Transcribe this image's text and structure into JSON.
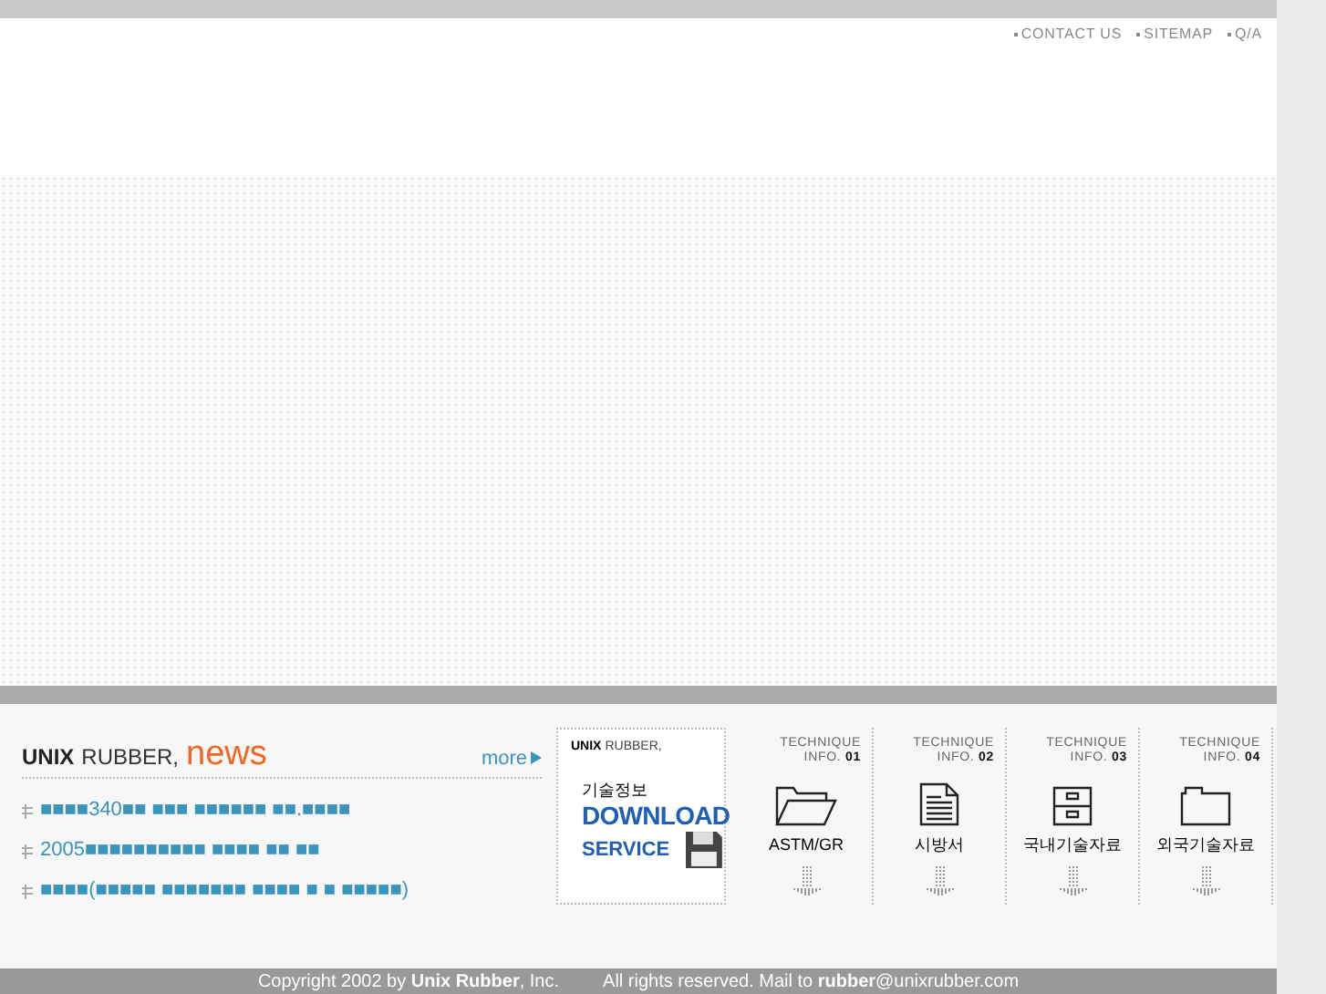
{
  "top_links": [
    "CONTACT US",
    "SITEMAP",
    "Q/A"
  ],
  "news": {
    "brand": "UNIX",
    "brand_rest": "RUBBER,",
    "title": "news",
    "more": "more",
    "items": [
      "■■■■340■■ ■■■ ■■■■■■ ■■.■■■■",
      "2005■■■■■■■■■■ ■■■■ ■■ ■■",
      "■■■■(■■■■■ ■■■■■■■ ■■■■ ■ ■ ■■■■■)"
    ]
  },
  "download": {
    "brand": "UNIX",
    "brand_rest": "RUBBER,",
    "label": "기술정보",
    "title": "DOWNLOAD",
    "subtitle": "SERVICE"
  },
  "technique": [
    {
      "line1": "TECHNIQUE",
      "line2": "INFO.",
      "number": "01",
      "label": "ASTM/GR",
      "kind": "open-folder"
    },
    {
      "line1": "TECHNIQUE",
      "line2": "INFO.",
      "number": "02",
      "label": "시방서",
      "kind": "document"
    },
    {
      "line1": "TECHNIQUE",
      "line2": "INFO.",
      "number": "03",
      "label": "국내기술자료",
      "kind": "cabinet"
    },
    {
      "line1": "TECHNIQUE",
      "line2": "INFO.",
      "number": "04",
      "label": "외국기술자료",
      "kind": "folder"
    }
  ],
  "footer": [
    "Copyright 2002 by **Unix Rubber**, Inc.",
    "All rights reserved. Mail to **rubber**@unixrubber.com"
  ]
}
